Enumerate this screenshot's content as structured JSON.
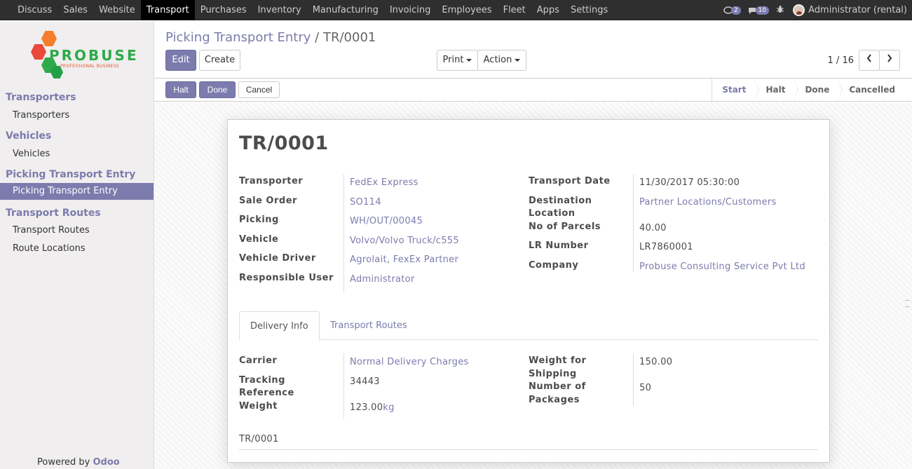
{
  "topbar": {
    "menu": [
      "Discuss",
      "Sales",
      "Website",
      "Transport",
      "Purchases",
      "Inventory",
      "Manufacturing",
      "Invoicing",
      "Employees",
      "Fleet",
      "Apps",
      "Settings"
    ],
    "active_menu": "Transport",
    "chat_count": "2",
    "message_count": "10",
    "user": "Administrator (rental)"
  },
  "sidebar": {
    "logo_text": "PROBUSE",
    "logo_sub": "PROFESSIONAL BUSINESS",
    "sections": [
      {
        "title": "Transporters",
        "items": [
          "Transporters"
        ]
      },
      {
        "title": "Vehicles",
        "items": [
          "Vehicles"
        ]
      },
      {
        "title": "Picking Transport Entry",
        "items": [
          "Picking Transport Entry"
        ]
      },
      {
        "title": "Transport Routes",
        "items": [
          "Transport Routes",
          "Route Locations"
        ]
      }
    ],
    "active_item": "Picking Transport Entry",
    "powered_prefix": "Powered by",
    "powered_brand": "Odoo"
  },
  "control": {
    "breadcrumb_parent": "Picking Transport Entry",
    "breadcrumb_sep": "/",
    "breadcrumb_current": "TR/0001",
    "edit": "Edit",
    "create": "Create",
    "print": "Print",
    "action": "Action",
    "pager": "1 / 16"
  },
  "statusbar": {
    "halt": "Halt",
    "done": "Done",
    "cancel": "Cancel",
    "stages": [
      "Start",
      "Halt",
      "Done",
      "Cancelled"
    ],
    "current_stage": "Start"
  },
  "form": {
    "title": "TR/0001",
    "left_fields": [
      {
        "label": "Transporter",
        "value": "FedEx Express"
      },
      {
        "label": "Sale Order",
        "value": "SO114"
      },
      {
        "label": "Picking",
        "value": "WH/OUT/00045"
      },
      {
        "label": "Vehicle",
        "value": "Volvo/Volvo Truck/c555"
      },
      {
        "label": "Vehicle Driver",
        "value": "Agrolait, FexEx Partner"
      },
      {
        "label": "Responsible User",
        "value": "Administrator"
      }
    ],
    "right_fields": {
      "transport_date_label": "Transport Date",
      "transport_date": "11/30/2017 05:30:00",
      "destination_label_1": "Destination",
      "destination_label_2": "Location",
      "destination": "Partner Locations/Customers",
      "parcels_label": "No of Parcels",
      "parcels": "40.00",
      "lr_label": "LR Number",
      "lr": "LR7860001",
      "company_label": "Company",
      "company": "Probuse Consulting Service Pvt Ltd"
    },
    "tabs": [
      "Delivery Info",
      "Transport Routes"
    ],
    "delivery": {
      "carrier_label": "Carrier",
      "carrier": "Normal Delivery Charges",
      "tracking_label_1": "Tracking",
      "tracking_label_2": "Reference",
      "tracking": "34443",
      "weight_label": "Weight",
      "weight": "123.00",
      "weight_unit": "kg",
      "wfs_label_1": "Weight for",
      "wfs_label_2": "Shipping",
      "wfs": "150.00",
      "pkg_label_1": "Number of",
      "pkg_label_2": "Packages",
      "pkg": "50"
    },
    "note": "TR/0001"
  }
}
